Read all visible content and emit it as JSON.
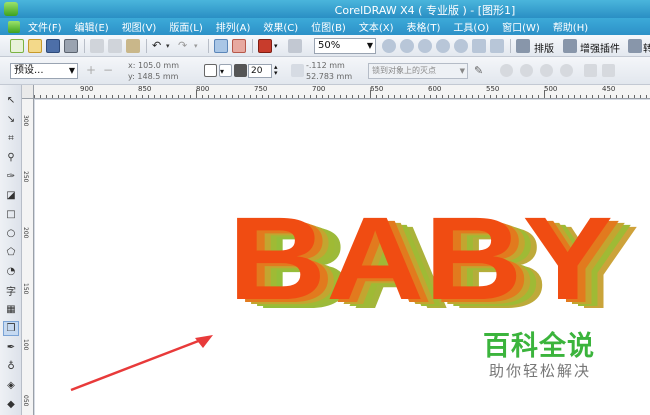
{
  "window": {
    "title": "CorelDRAW X4 ( 专业版 ) - [图形1]"
  },
  "menu": [
    "文件(F)",
    "编辑(E)",
    "视图(V)",
    "版面(L)",
    "排列(A)",
    "效果(C)",
    "位图(B)",
    "文本(X)",
    "表格(T)",
    "工具(O)",
    "窗口(W)",
    "帮助(H)"
  ],
  "toolbar": {
    "zoom_value": "50%",
    "layout_label": "排版",
    "plugin_label": "增强插件",
    "cut_label": "转"
  },
  "propbar": {
    "preset": "预设...",
    "x": "x:  105.0 mm",
    "y": "y:  148.5 mm",
    "depth": "20",
    "vp_x": "-.112 mm",
    "vp_y": "52.783 mm",
    "vanishing_point": "锁到对象上的灭点"
  },
  "ruler": {
    "h_labels": [
      "900",
      "850",
      "800",
      "750",
      "700",
      "650",
      "600",
      "550",
      "500",
      "450"
    ],
    "v_labels": [
      "300",
      "250",
      "200",
      "150",
      "100",
      "050",
      "000"
    ]
  },
  "artwork": {
    "text": "BABY",
    "front_color": "#f04c12",
    "extrude_color": "#8fc03a"
  },
  "watermark": {
    "title": "百科全说",
    "subtitle": "助你轻松解决",
    "title_color": "#3bb43c"
  },
  "arrow_color": "#e83a3a"
}
